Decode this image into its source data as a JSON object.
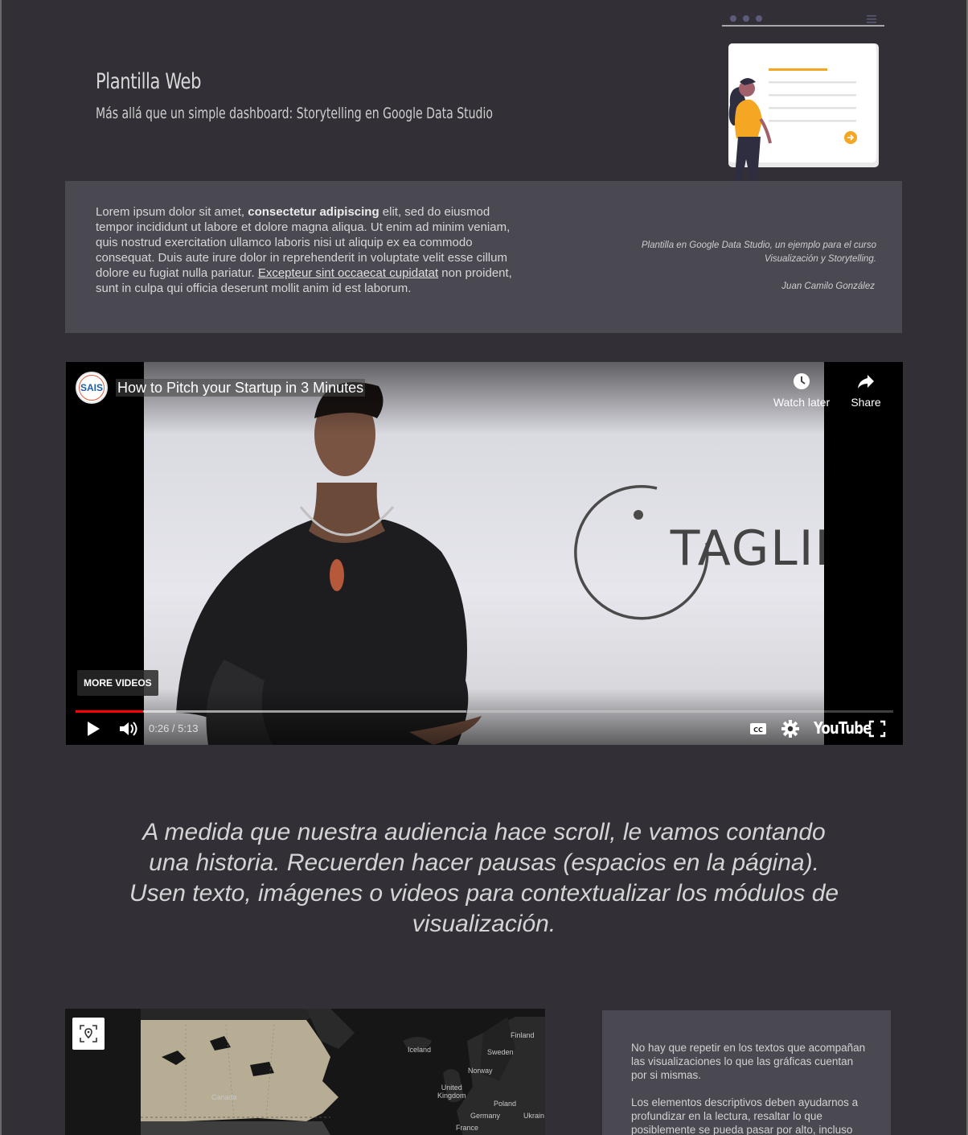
{
  "header": {
    "title": "Plantilla Web",
    "subtitle": "Más allá que un simple dashboard: Storytelling en Google Data Studio"
  },
  "intro": {
    "text_part1": "Lorem ipsum dolor sit amet, ",
    "text_bold": "consectetur adipiscing",
    "text_part2": " elit, sed do eiusmod tempor incididunt ut labore et dolore magna aliqua. Ut enim ad minim veniam, quis nostrud exercitation ullamco laboris nisi ut aliquip ex ea commodo consequat. Duis aute irure dolor in reprehenderit in voluptate velit esse cillum dolore eu fugiat nulla pariatur. ",
    "text_link": "Excepteur sint occaecat cupidatat",
    "text_part3": " non proident, sunt in culpa qui officia deserunt mollit anim id est laborum.",
    "credit_line1": "Plantilla en Google Data Studio, un ejemplo para el curso",
    "credit_line2": "Visualización y Storytelling.",
    "credit_author": "Juan Camilo González"
  },
  "video": {
    "channel_logo_text": "SAIS",
    "title": "How to Pitch your Startup in 3 Minutes",
    "watch_later_label": "Watch later",
    "share_label": "Share",
    "more_videos_label": "MORE VIDEOS",
    "time": "0:26 / 5:13",
    "played_fraction": 0.083,
    "loaded_fraction": 0.478,
    "youtube_label": "YouTube",
    "tagline_text": "TAGLINE"
  },
  "story": {
    "text": "A medida que nuestra audiencia hace scroll, le vamos contando una historia. Recuerden hacer pausas (espacios en la página). Usen texto, imágenes o videos para contextualizar los módulos de visualización."
  },
  "map": {
    "labels": {
      "canada": "Canada",
      "iceland": "Iceland",
      "finland": "Finland",
      "sweden": "Sweden",
      "norway": "Norway",
      "united_kingdom": "United\nKingdom",
      "poland": "Poland",
      "germany": "Germany",
      "ukraine": "Ukrain",
      "france": "France"
    }
  },
  "side_panel": {
    "paragraph1": "No hay que repetir en los textos que acompañan las visualizaciones lo que las gráficas cuentan por si mismas.",
    "paragraph2": "Los elementos descriptivos deben ayudarnos a profundizar en la lectura, resaltar lo que posiblemente se pueda pasar por alto, incluso"
  },
  "colors": {
    "background": "#323036",
    "panel": "#4a4850",
    "accent_orange": "#f5a623",
    "youtube_red": "#ff0000"
  }
}
